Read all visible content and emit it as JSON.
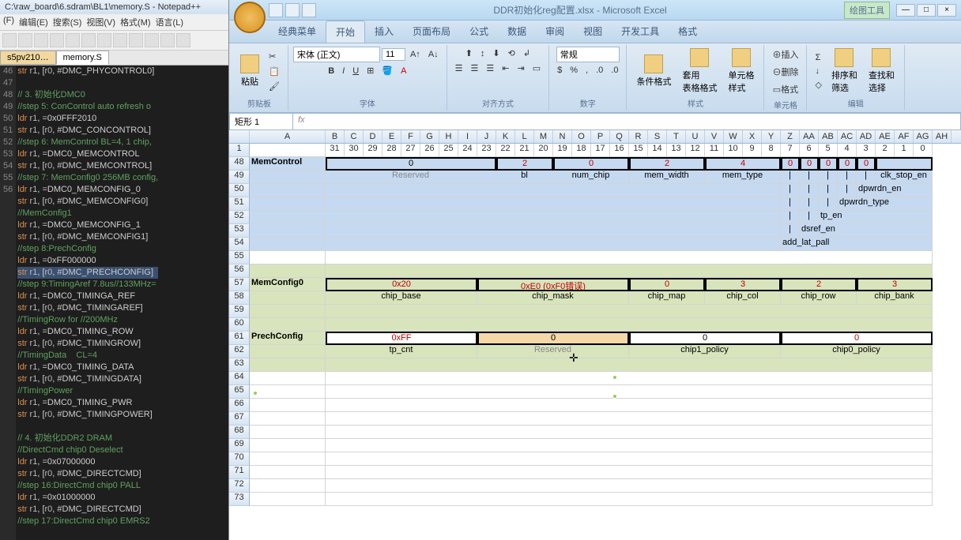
{
  "notepad": {
    "title": "C:\\raw_board\\6.sdram\\BL1\\memory.S - Notepad++",
    "menus": [
      "(F)",
      "编辑(E)",
      "搜索(S)",
      "视图(V)",
      "格式(M)",
      "语言(L)"
    ],
    "tabs": {
      "inactive": "s5pv210…",
      "active": "memory.S"
    },
    "code": [
      {
        "n": "",
        "t": "str r1, [r0, #DMC_PHYCONTROL0]",
        "c": ""
      },
      {
        "n": "",
        "t": "",
        "c": ""
      },
      {
        "n": "",
        "t": "",
        "c": "// 3. 初始化DMC0"
      },
      {
        "n": "",
        "t": "",
        "c": "//step 5: ConControl auto refresh o"
      },
      {
        "n": "46",
        "t": "ldr r1, =0x0FFF2010",
        "c": ""
      },
      {
        "n": "",
        "t": "str r1, [r0, #DMC_CONCONTROL]",
        "c": ""
      },
      {
        "n": "",
        "t": "",
        "c": "//step 6: MemControl BL=4, 1 chip,"
      },
      {
        "n": "47",
        "t": "ldr r1, =DMC0_MEMCONTROL",
        "c": ""
      },
      {
        "n": "",
        "t": "str r1, [r0, #DMC_MEMCONTROL]",
        "c": ""
      },
      {
        "n": "",
        "t": "",
        "c": "//step 7: MemConfig0 256MB config,"
      },
      {
        "n": "48",
        "t": "ldr r1, =DMC0_MEMCONFIG_0",
        "c": ""
      },
      {
        "n": "",
        "t": "str r1, [r0, #DMC_MEMCONFIG0]",
        "c": ""
      },
      {
        "n": "",
        "t": "",
        "c": "//MemConfig1"
      },
      {
        "n": "49",
        "t": "ldr r1, =DMC0_MEMCONFIG_1",
        "c": ""
      },
      {
        "n": "",
        "t": "str r1, [r0, #DMC_MEMCONFIG1]",
        "c": ""
      },
      {
        "n": "",
        "t": "",
        "c": "//step 8:PrechConfig"
      },
      {
        "n": "50",
        "t": "ldr r1, =0xFF000000",
        "c": ""
      },
      {
        "n": "",
        "t": "str r1, [r0, #DMC_PRECHCONFIG]",
        "c": "",
        "sel": true
      },
      {
        "n": "",
        "t": "",
        "c": "//step 9:TimingAref 7.8us//133MHz="
      },
      {
        "n": "51",
        "t": "ldr r1, =DMC0_TIMINGA_REF",
        "c": ""
      },
      {
        "n": "",
        "t": "str r1, [r0, #DMC_TIMINGAREF]",
        "c": ""
      },
      {
        "n": "",
        "t": "",
        "c": "//TimingRow for //200MHz"
      },
      {
        "n": "52",
        "t": "ldr r1, =DMC0_TIMING_ROW",
        "c": ""
      },
      {
        "n": "",
        "t": "str r1, [r0, #DMC_TIMINGROW]",
        "c": ""
      },
      {
        "n": "",
        "t": "",
        "c": "//TimingData    CL=4"
      },
      {
        "n": "53",
        "t": "ldr r1, =DMC0_TIMING_DATA",
        "c": ""
      },
      {
        "n": "",
        "t": "str r1, [r0, #DMC_TIMINGDATA]",
        "c": ""
      },
      {
        "n": "",
        "t": "",
        "c": "//TimingPower"
      },
      {
        "n": "54",
        "t": "ldr r1, =DMC0_TIMING_PWR",
        "c": ""
      },
      {
        "n": "",
        "t": "str r1, [r0, #DMC_TIMINGPOWER]",
        "c": ""
      },
      {
        "n": "",
        "t": "",
        "c": ""
      },
      {
        "n": "",
        "t": "",
        "c": "// 4. 初始化DDR2 DRAM"
      },
      {
        "n": "",
        "t": "",
        "c": "//DirectCmd chip0 Deselect"
      },
      {
        "n": "55",
        "t": "ldr r1, =0x07000000",
        "c": ""
      },
      {
        "n": "",
        "t": "str r1, [r0, #DMC_DIRECTCMD]",
        "c": ""
      },
      {
        "n": "",
        "t": "",
        "c": "//step 16:DirectCmd chip0 PALL"
      },
      {
        "n": "56",
        "t": "ldr r1, =0x01000000",
        "c": ""
      },
      {
        "n": "",
        "t": "str r1, [r0, #DMC_DIRECTCMD]",
        "c": ""
      },
      {
        "n": "",
        "t": "",
        "c": "//step 17:DirectCmd chip0 EMRS2"
      }
    ]
  },
  "excel": {
    "filename": "DDR初始化reg配置.xlsx - Microsoft Excel",
    "drawtools": "绘图工具",
    "ribbon_tabs": [
      "经典菜单",
      "开始",
      "插入",
      "页面布局",
      "公式",
      "数据",
      "审阅",
      "视图",
      "开发工具",
      "格式"
    ],
    "active_tab_index": 1,
    "font_name": "宋体 (正文)",
    "font_size": "11",
    "number_format": "常规",
    "groups": {
      "clipboard": "剪贴板",
      "paste": "粘贴",
      "font": "字体",
      "align": "对齐方式",
      "number": "数字",
      "styles": "样式",
      "cond": "条件格式",
      "table": "套用\n表格格式",
      "cellstyle": "单元格\n样式",
      "insert": "插入",
      "delete": "删除",
      "format": "格式",
      "cells": "单元格",
      "sort": "排序和\n筛选",
      "find": "查找和\n选择",
      "edit": "编辑"
    },
    "namebox": "矩形 1",
    "cols": [
      "A",
      "B",
      "C",
      "D",
      "E",
      "F",
      "G",
      "H",
      "I",
      "J",
      "K",
      "L",
      "M",
      "N",
      "O",
      "P",
      "Q",
      "R",
      "S",
      "T",
      "U",
      "V",
      "W",
      "X",
      "Y",
      "Z",
      "AA",
      "AB",
      "AC",
      "AD",
      "AE",
      "AF",
      "AG",
      "AH"
    ],
    "bit_numbers": [
      "31",
      "30",
      "29",
      "28",
      "27",
      "26",
      "25",
      "24",
      "23",
      "22",
      "21",
      "20",
      "19",
      "18",
      "17",
      "16",
      "15",
      "14",
      "13",
      "12",
      "11",
      "10",
      "9",
      "8",
      "7",
      "6",
      "5",
      "4",
      "3",
      "2",
      "1",
      "0"
    ],
    "row_nums": [
      "1",
      "48",
      "49",
      "50",
      "51",
      "52",
      "53",
      "54",
      "55",
      "56",
      "57",
      "58",
      "59",
      "60",
      "61",
      "62",
      "63",
      "64",
      "65",
      "66",
      "67",
      "68",
      "69",
      "70",
      "71",
      "72",
      "73"
    ],
    "memcontrol": {
      "label": "MemControl",
      "vals": [
        "0",
        "2",
        "0",
        "2",
        "4",
        "0",
        "0",
        "0",
        "0",
        "0"
      ],
      "fields": [
        "Reserved",
        "bl",
        "num_chip",
        "mem_width",
        "mem_type",
        "clk_stop_en",
        "dpwrdn_en",
        "dpwrdn_type",
        "tp_en",
        "dsref_en",
        "add_lat_pall"
      ],
      "pipe": "|"
    },
    "memconfig0": {
      "label": "MemConfig0",
      "vals": [
        "0x20",
        "0xE0 (0xF0错误)",
        "0",
        "3",
        "2",
        "3"
      ],
      "fields": [
        "chip_base",
        "chip_mask",
        "chip_map",
        "chip_col",
        "chip_row",
        "chip_bank"
      ]
    },
    "prechconfig": {
      "label": "PrechConfig",
      "vals": [
        "0xFF",
        "0",
        "0",
        "0"
      ],
      "fields": [
        "tp_cnt",
        "Reserved",
        "chip1_policy",
        "chip0_policy"
      ]
    }
  }
}
